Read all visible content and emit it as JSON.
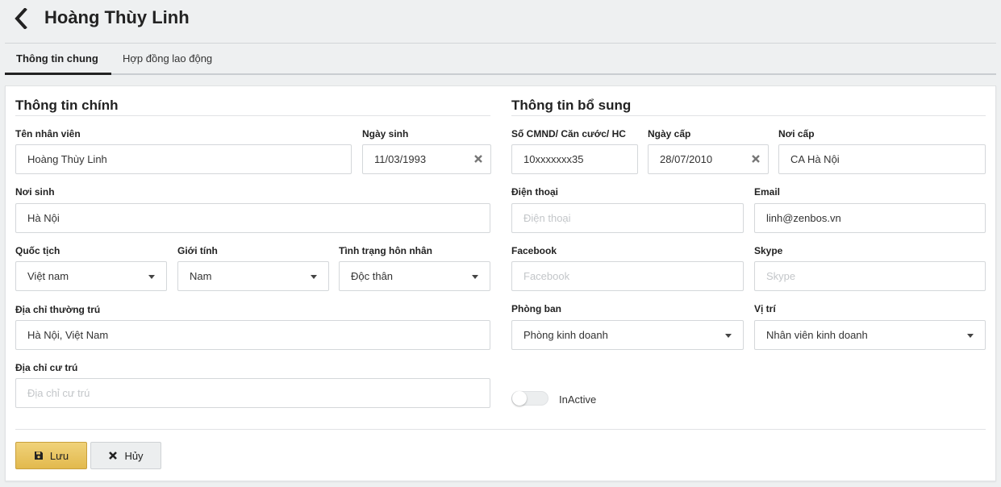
{
  "header": {
    "title": "Hoàng Thùy Linh"
  },
  "tabs": [
    {
      "label": "Thông tin chung"
    },
    {
      "label": "Hợp đồng lao động"
    }
  ],
  "main_info": {
    "title": "Thông tin chính",
    "employee_name": {
      "label": "Tên nhân viên",
      "value": "Hoàng Thùy Linh"
    },
    "birth_date": {
      "label": "Ngày sinh",
      "value": "11/03/1993"
    },
    "birth_place": {
      "label": "Nơi sinh",
      "value": "Hà Nội"
    },
    "nationality": {
      "label": "Quốc tịch",
      "value": "Việt nam"
    },
    "gender": {
      "label": "Giới tính",
      "value": "Nam"
    },
    "marital_status": {
      "label": "Tình trạng hôn nhân",
      "value": "Độc thân"
    },
    "permanent_address": {
      "label": "Địa chỉ thường trú",
      "value": "Hà Nội, Việt Nam"
    },
    "current_address": {
      "label": "Địa chỉ cư trú",
      "value": "",
      "placeholder": "Địa chỉ cư trú"
    }
  },
  "extra_info": {
    "title": "Thông tin bổ sung",
    "id_number": {
      "label": "Số CMND/ Căn cước/ HC",
      "value": "10xxxxxxx35"
    },
    "issue_date": {
      "label": "Ngày cấp",
      "value": "28/07/2010"
    },
    "issue_place": {
      "label": "Nơi cấp",
      "value": "CA Hà Nội"
    },
    "phone": {
      "label": "Điện thoại",
      "value": "",
      "placeholder": "Điện thoại"
    },
    "email": {
      "label": "Email",
      "value": "linh@zenbos.vn"
    },
    "facebook": {
      "label": "Facebook",
      "value": "",
      "placeholder": "Facebook"
    },
    "skype": {
      "label": "Skype",
      "value": "",
      "placeholder": "Skype"
    },
    "department": {
      "label": "Phòng ban",
      "value": "Phòng kinh doanh"
    },
    "position": {
      "label": "Vị trí",
      "value": "Nhân viên kinh doanh"
    },
    "status_toggle": {
      "label": "InActive",
      "on": false
    }
  },
  "actions": {
    "save_label": "Lưu",
    "cancel_label": "Hủy"
  },
  "colors": {
    "accent": "#e8c463",
    "background": "#eef0f1"
  }
}
